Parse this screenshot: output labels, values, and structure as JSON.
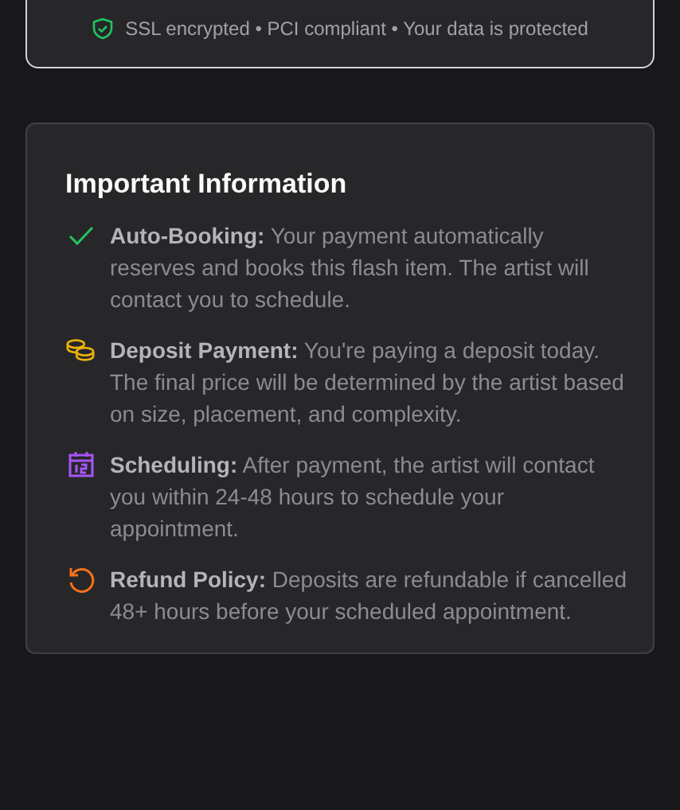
{
  "security_note": {
    "text": "SSL encrypted • PCI compliant • Your data is protected"
  },
  "info_card": {
    "title": "Important Information",
    "items": [
      {
        "kind": "check",
        "color": "#22c55e",
        "text": "**Auto-Booking:** Your payment automatically reserves and books this flash item. The artist will contact you to schedule."
      },
      {
        "kind": "coins",
        "color": "#eab308",
        "text": "**Deposit Payment:** You're paying a deposit today. The final price will be determined by the artist based on size, placement, and complexity."
      },
      {
        "kind": "calendar",
        "color": "#a855f7",
        "text": "**Scheduling:** After payment, the artist will contact you within 24-48 hours to schedule your appointment."
      },
      {
        "kind": "refund",
        "color": "#f97316",
        "text": "**Refund Policy:** Deposits are refundable if cancelled 48+ hours before your scheduled appointment."
      }
    ]
  }
}
